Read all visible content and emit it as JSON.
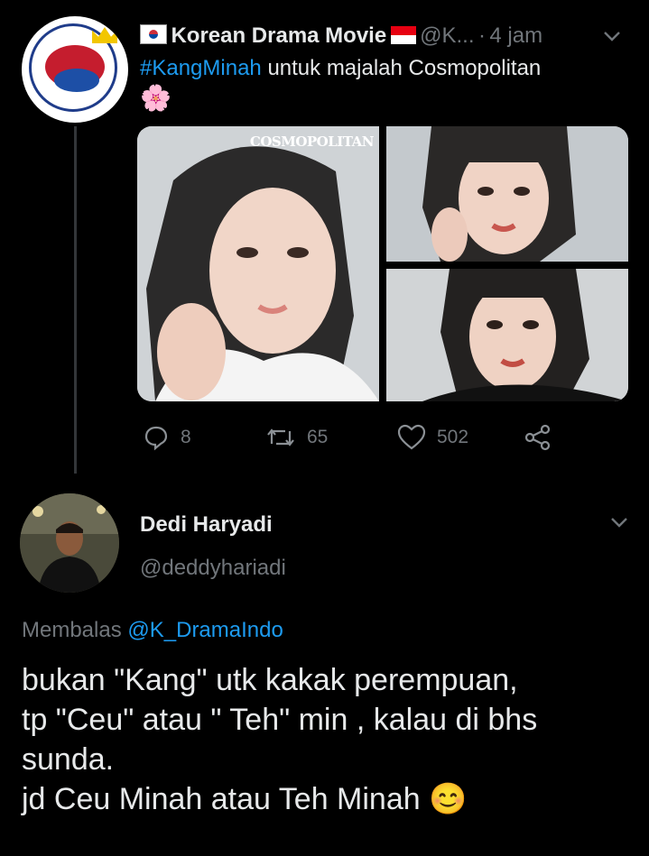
{
  "tweet": {
    "display_name": "Korean Drama Movie",
    "handle": "@K...",
    "separator": "·",
    "time": "4 jam",
    "hashtag": "#KangMinah",
    "text": "untuk majalah Cosmopolitan",
    "emoji": "🌸",
    "images": [
      {
        "label": "COSMOPOLITAN"
      }
    ],
    "actions": {
      "replies": "8",
      "retweets": "65",
      "likes": "502"
    }
  },
  "reply": {
    "display_name": "Dedi Haryadi",
    "handle": "@deddyhariadi",
    "replying_prefix": "Membalas",
    "replying_to": "@K_DramaIndo",
    "lines": [
      "bukan \"Kang\" utk kakak perempuan,",
      "tp \"Ceu\" atau \" Teh\" min , kalau di bhs",
      "sunda.",
      "jd Ceu Minah atau Teh Minah"
    ],
    "emoji": "😊"
  },
  "colors": {
    "background": "#000000",
    "text": "#e7e9ea",
    "muted": "#71767b",
    "link": "#1d9bf0"
  }
}
